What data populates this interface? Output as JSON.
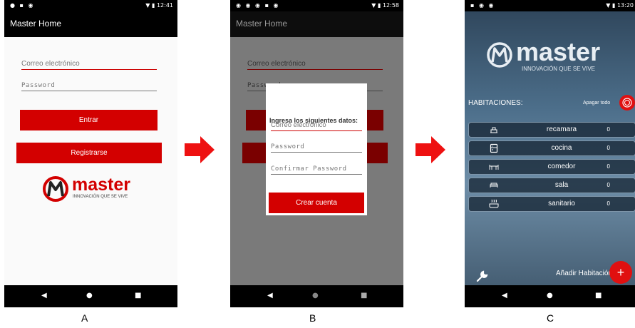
{
  "status": {
    "a_time": "12:41",
    "b_time": "12:58",
    "c_time": "13:20"
  },
  "login": {
    "app_title": "Master Home",
    "email_placeholder": "Correo electrónico",
    "password_placeholder": "Password",
    "enter_label": "Entrar",
    "register_label": "Registrarse"
  },
  "logo": {
    "brand": "master",
    "tagline": "INNOVACIÓN QUE SE VIVE"
  },
  "dialog": {
    "title": "Ingresa los siguientes datos:",
    "email_placeholder": "Correo electrónico",
    "password_placeholder": "Password",
    "confirm_placeholder": "Confirmar Password",
    "create_label": "Crear cuenta"
  },
  "rooms_screen": {
    "brand": "master",
    "tagline": "INNOVACIÓN QUE SE VIVE",
    "heading": "HABITACIONES:",
    "all_off_label": "Apagar todo",
    "add_room_label": "Añadir Habitación",
    "rooms": [
      {
        "name": "recamara",
        "count": "0",
        "icon": "bed-icon"
      },
      {
        "name": "cocina",
        "count": "0",
        "icon": "fridge-icon"
      },
      {
        "name": "comedor",
        "count": "0",
        "icon": "dining-table-icon"
      },
      {
        "name": "sala",
        "count": "0",
        "icon": "sofa-icon"
      },
      {
        "name": "sanitario",
        "count": "0",
        "icon": "bathtub-icon"
      }
    ]
  },
  "panel_labels": {
    "a": "A",
    "b": "B",
    "c": "C"
  },
  "colors": {
    "accent_red": "#d30000",
    "bar_black": "#000000",
    "dialog_white": "#ffffff",
    "rooms_bg": "#4c6e8a"
  }
}
